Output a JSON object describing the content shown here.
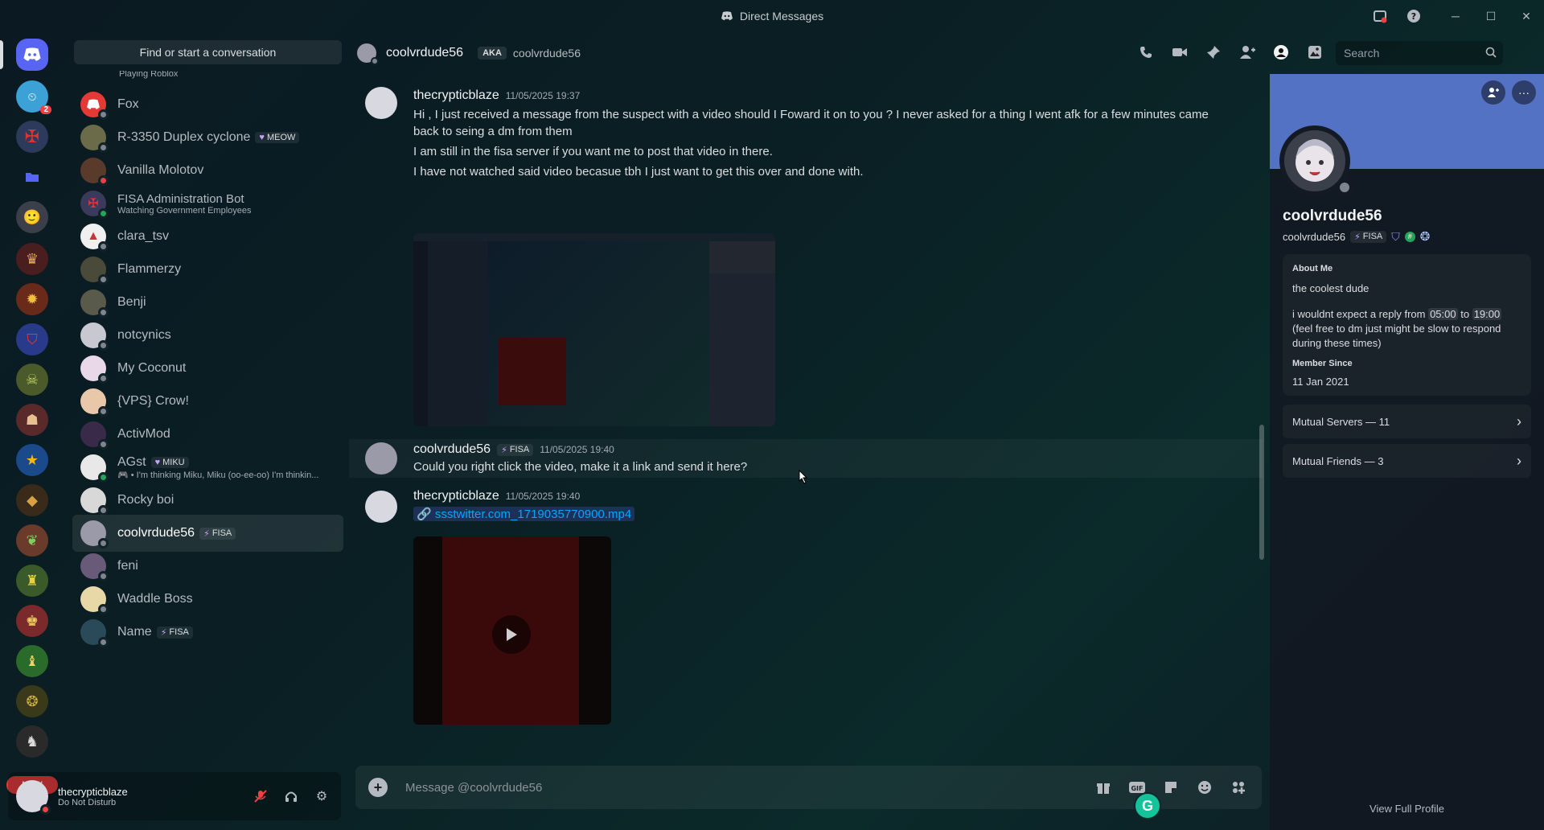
{
  "window": {
    "title": "Direct Messages"
  },
  "rail": {
    "badge_count": "2",
    "new_label": "NEW"
  },
  "sidebar": {
    "find_placeholder": "Find or start a conversation",
    "dms": [
      {
        "name": "",
        "sub": "Playing Roblox",
        "status": "online"
      },
      {
        "name": "Fox",
        "sub": "",
        "status": "offline",
        "tag": ""
      },
      {
        "name": "R-3350 Duplex cyclone",
        "sub": "",
        "status": "offline",
        "tag": "MEOW"
      },
      {
        "name": "Vanilla Molotov",
        "sub": "",
        "status": "dnd",
        "tag": ""
      },
      {
        "name": "FISA Administration Bot",
        "sub": "Watching Government Employees",
        "status": "online",
        "tag": ""
      },
      {
        "name": "clara_tsv",
        "sub": "",
        "status": "offline",
        "tag": ""
      },
      {
        "name": "Flammerzy",
        "sub": "",
        "status": "offline",
        "tag": ""
      },
      {
        "name": "Benji",
        "sub": "",
        "status": "offline",
        "tag": ""
      },
      {
        "name": "notcynics",
        "sub": "",
        "status": "offline",
        "tag": ""
      },
      {
        "name": "My Coconut",
        "sub": "",
        "status": "offline",
        "tag": ""
      },
      {
        "name": "{VPS} Crow!",
        "sub": "",
        "status": "offline",
        "tag": ""
      },
      {
        "name": "ActivMod",
        "sub": "",
        "status": "offline",
        "tag": ""
      },
      {
        "name": "AGst",
        "sub": "• I'm thinking Miku, Miku (oo-ee-oo) I'm thinkin...",
        "status": "online",
        "tag": "MIKU"
      },
      {
        "name": "Rocky boi",
        "sub": "",
        "status": "offline",
        "tag": ""
      },
      {
        "name": "coolvrdude56",
        "sub": "",
        "status": "offline",
        "tag": "FISA"
      },
      {
        "name": "feni",
        "sub": "",
        "status": "offline",
        "tag": ""
      },
      {
        "name": "Waddle Boss",
        "sub": "",
        "status": "offline",
        "tag": ""
      },
      {
        "name": "Name",
        "sub": "",
        "status": "offline",
        "tag": "FISA"
      }
    ]
  },
  "user_panel": {
    "name": "thecrypticblaze",
    "status": "Do Not Disturb"
  },
  "header": {
    "name": "coolvrdude56",
    "aka_label": "AKA",
    "aka_name": "coolvrdude56",
    "search_placeholder": "Search"
  },
  "messages": [
    {
      "author": "thecrypticblaze",
      "time": "11/05/2025 19:37",
      "lines": [
        "Hi , I just received a message from the suspect with a video should I Foward it on to you ? I never asked for a thing I went afk for a few minutes came back to seing a dm from them",
        "I am still in the fisa server if you want me to post that video in there.",
        "I have not watched said video becasue tbh I just want to get this over and done with."
      ]
    },
    {
      "author": "coolvrdude56",
      "tag": "FISA",
      "time": "11/05/2025 19:40",
      "lines": [
        "Could you right click the video, make it a link and send it here?"
      ]
    },
    {
      "author": "thecrypticblaze",
      "time": "11/05/2025 19:40",
      "link": "ssstwitter.com_1719035770900.mp4"
    }
  ],
  "composer": {
    "placeholder": "Message @coolvrdude56"
  },
  "profile": {
    "display_name": "coolvrdude56",
    "handle": "coolvrdude56",
    "tag": "FISA",
    "about_label": "About Me",
    "about_line1": "the coolest dude",
    "about_pre": "i wouldnt expect a reply from ",
    "about_from": "05:00",
    "about_mid": " to ",
    "about_to": "19:00",
    "about_post": " (feel free to dm just might be slow to respond during these times)",
    "member_since_label": "Member Since",
    "member_since": "11 Jan 2021",
    "mutual_servers": "Mutual Servers — 11",
    "mutual_friends": "Mutual Friends — 3",
    "view_full": "View Full Profile"
  },
  "colors": {
    "accent": "#5865f2",
    "banner": "#5472c4",
    "online": "#23a55a",
    "dnd": "#f23f43"
  }
}
